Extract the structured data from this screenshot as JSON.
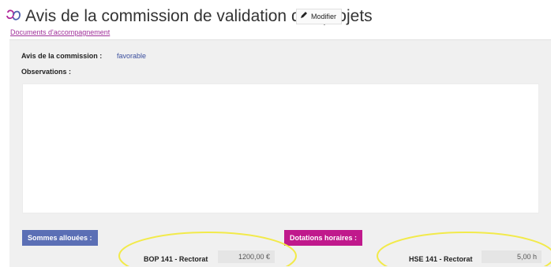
{
  "header": {
    "title": "Avis de la commission de validation des projets",
    "edit_label": "Modifier",
    "docs_link": "Documents d'accompagnement"
  },
  "commission": {
    "avis_label": "Avis de la commission :",
    "avis_value": "favorable",
    "observations_label": "Observations :",
    "observations_value": ""
  },
  "sommes": {
    "button_label": "Sommes allouées :",
    "rows": [
      {
        "label": "BOP 141 - Rectorat",
        "value": "1200,00 €"
      }
    ]
  },
  "dotations": {
    "button_label": "Dotations horaires :",
    "rows": [
      {
        "label": "HSE 141 - Rectorat",
        "value": "5,00 h"
      }
    ]
  },
  "colors": {
    "sommes_button": "#5b6fb5",
    "dotations_button": "#c0198c",
    "link": "#a0309a",
    "avis_value": "#3b4f9e",
    "highlight": "#f2ea4a"
  },
  "icons": {
    "logo": "app-logo-icon",
    "edit": "pencil-icon"
  }
}
